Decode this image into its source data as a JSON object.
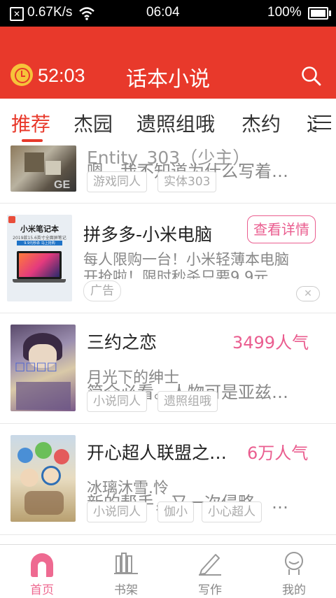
{
  "status": {
    "speed": "0.67K/s",
    "time": "06:04",
    "battery": "100%"
  },
  "header": {
    "timer": "52:03",
    "title": "话本小说",
    "alarm_icon": "alarm-clock-icon",
    "search_icon": "search-icon"
  },
  "tabs": [
    "推荐",
    "杰园",
    "遗照组哦",
    "杰约",
    "这"
  ],
  "items": [
    {
      "title": "Entity_303（少主）",
      "desc": "嗯，我不知道为什么写着…",
      "tags": [
        "游戏同人",
        "实体303"
      ]
    },
    {
      "ad": true,
      "title": "拼多多-小米电脑",
      "button": "查看详情",
      "desc1": "每人限购一台！小米轻薄本电脑",
      "desc2": "开抢啦！限时秒杀只要9.9元",
      "tag": "广告",
      "cover_title": "小米笔记本",
      "cover_sub": "2019款15.6英寸全面屏笔记",
      "cover_price": "9.9元秒杀 马上抢购"
    },
    {
      "title": "三约之恋",
      "popularity": "3499人气",
      "author": "月光下的绅士",
      "desc": "简介必看。人物可是亚兹…",
      "tags": [
        "小说同人",
        "遗照组哦"
      ]
    },
    {
      "title": "开心超人联盟之…",
      "popularity": "6万人气",
      "author": "冰璃沐雪.怜",
      "desc": "新的帮手，又一次侵略，…",
      "tags": [
        "小说同人",
        "伽小",
        "小心超人"
      ]
    }
  ],
  "nav": [
    {
      "label": "首页",
      "icon": "home-icon",
      "active": true
    },
    {
      "label": "书架",
      "icon": "bookshelf-icon"
    },
    {
      "label": "写作",
      "icon": "pen-icon"
    },
    {
      "label": "我的",
      "icon": "profile-icon"
    }
  ],
  "colors": {
    "brand": "#e8392b",
    "popularity": "#ea5d8f",
    "nav_active": "#ee6a91"
  }
}
